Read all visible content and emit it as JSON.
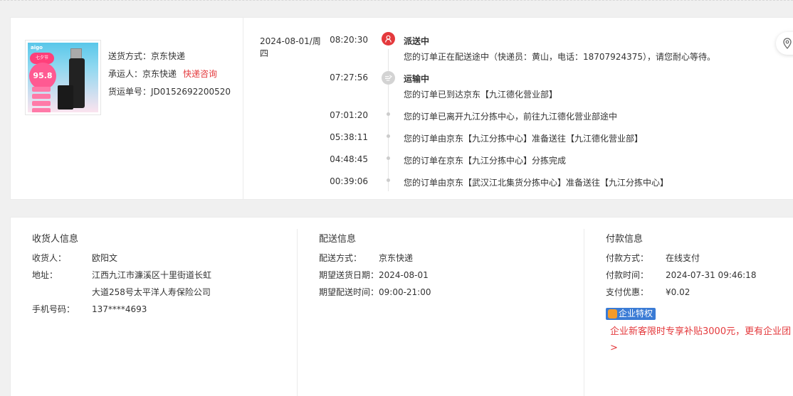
{
  "shipment": {
    "product_image_alt": "aigo U盘",
    "delivery_method_label": "送货方式：",
    "delivery_method_value": "京东快递",
    "carrier_label": "承运人：",
    "carrier_value": "京东快递",
    "carrier_link": "快递咨询",
    "tracking_label": "货运单号：",
    "tracking_value": "JD0152692200520",
    "thumb": {
      "brand": "aigo",
      "badge": "七夕节",
      "price": "95.8"
    }
  },
  "timeline": {
    "date": "2024-08-01/周四",
    "events": [
      {
        "time": "08:20:30",
        "status": "派送中",
        "text": "您的订单正在配送途中（快递员：黄山，电话：18707924375），请您耐心等待。",
        "icon": "delivery-person-icon"
      },
      {
        "time": "07:27:56",
        "status": "运输中",
        "text": "您的订单已到达京东【九江德化营业部】",
        "icon": "transport-truck-icon"
      },
      {
        "time": "07:01:20",
        "status": "",
        "text": "您的订单已离开九江分拣中心，前往九江德化营业部途中"
      },
      {
        "time": "05:38:11",
        "status": "",
        "text": "您的订单由京东【九江分拣中心】准备送往【九江德化营业部】"
      },
      {
        "time": "04:48:45",
        "status": "",
        "text": "您的订单在京东【九江分拣中心】分拣完成"
      },
      {
        "time": "00:39:06",
        "status": "",
        "text": "您的订单由京东【武汉江北集货分拣中心】准备送往【九江分拣中心】"
      }
    ]
  },
  "float_button": {
    "icon": "map-pin-icon"
  },
  "receiver": {
    "title": "收货人信息",
    "name_label": "收货人：",
    "name_value": "欧阳文",
    "address_label": "地址：",
    "address_line1": "江西九江市濂溪区十里街道长虹",
    "address_line2": "大道258号太平洋人寿保险公司",
    "phone_label": "手机号码：",
    "phone_value": "137****4693"
  },
  "delivery": {
    "title": "配送信息",
    "method_label": "配送方式：",
    "method_value": "京东快递",
    "date_label": "期望送货日期：",
    "date_value": "2024-08-01",
    "time_label": "期望配送时间：",
    "time_value": "09:00-21:00"
  },
  "payment": {
    "title": "付款信息",
    "method_label": "付款方式：",
    "method_value": "在线支付",
    "time_label": "付款时间：",
    "time_value": "2024-07-31 09:46:18",
    "discount_label": "支付优惠：",
    "discount_value": "¥0.02",
    "badge_label": "企业特权",
    "promo_text": "企业新客限时专享补贴3000元，更有企业团",
    "promo_arrow": ">"
  },
  "colors": {
    "accent_red": "#e4393c",
    "badge_blue": "#3a7bd5"
  }
}
